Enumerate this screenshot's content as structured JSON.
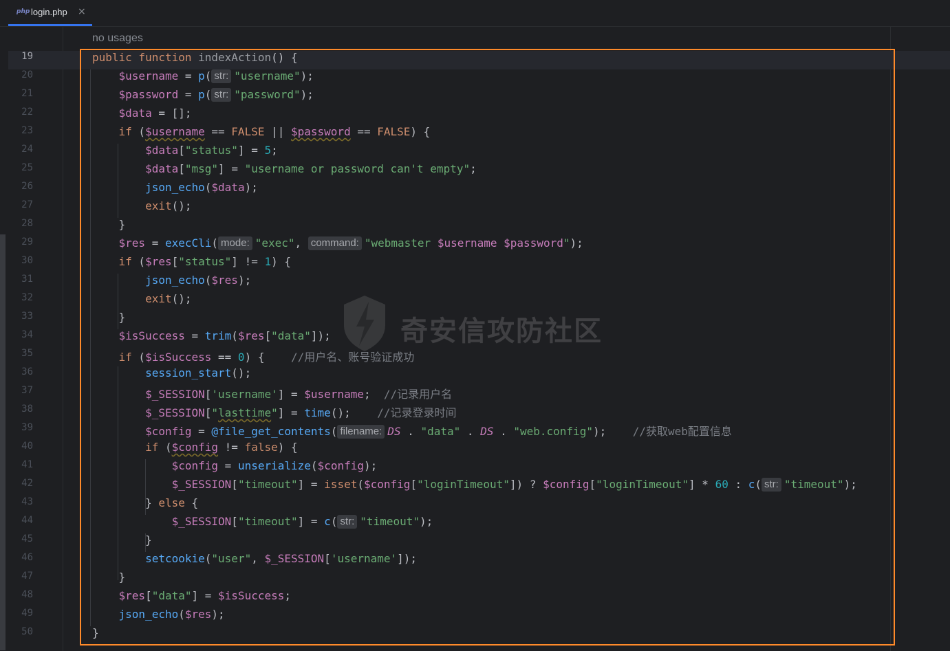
{
  "tab": {
    "icon": "php",
    "title": "login.php",
    "close": "×"
  },
  "hint_no_usages": "no usages",
  "lines": [
    {
      "ln": "19",
      "html": "<span class=\"t-kw\">public function</span> <span class=\"t-dim\">indexAction</span>() {"
    },
    {
      "ln": "20",
      "html": "    <span class=\"t-var\">$username</span> = <span class=\"t-fn\">p</span>(<span class=\"hint\">str:</span><span class=\"t-str\">\"username\"</span>);"
    },
    {
      "ln": "21",
      "html": "    <span class=\"t-var\">$password</span> = <span class=\"t-fn\">p</span>(<span class=\"hint\">str:</span><span class=\"t-str\">\"password\"</span>);"
    },
    {
      "ln": "22",
      "html": "    <span class=\"t-var\">$data</span> = [];"
    },
    {
      "ln": "23",
      "html": "    <span class=\"t-kw\">if</span> (<span class=\"t-var warn\">$username</span> == <span class=\"t-kw\">FALSE</span> || <span class=\"t-var warn\">$password</span> == <span class=\"t-kw\">FALSE</span>) {"
    },
    {
      "ln": "24",
      "html": "        <span class=\"t-var\">$data</span>[<span class=\"t-str\">\"status\"</span>] = <span class=\"t-num\">5</span>;"
    },
    {
      "ln": "25",
      "html": "        <span class=\"t-var\">$data</span>[<span class=\"t-str\">\"msg\"</span>] = <span class=\"t-str\">\"username or password can't empty\"</span>;"
    },
    {
      "ln": "26",
      "html": "        <span class=\"t-fn\">json_echo</span>(<span class=\"t-var\">$data</span>);"
    },
    {
      "ln": "27",
      "html": "        <span class=\"t-kw\">exit</span>();"
    },
    {
      "ln": "28",
      "html": "    }"
    },
    {
      "ln": "29",
      "html": "    <span class=\"t-var\">$res</span> = <span class=\"t-fn\">execCli</span>(<span class=\"hint\">mode:</span><span class=\"t-str\">\"exec\"</span>, <span class=\"hint\">command:</span><span class=\"t-str\">\"webmaster <span class=\"t-var\">$username</span> <span class=\"t-var\">$password</span>\"</span>);"
    },
    {
      "ln": "30",
      "html": "    <span class=\"t-kw\">if</span> (<span class=\"t-var\">$res</span>[<span class=\"t-str\">\"status\"</span>] != <span class=\"t-num\">1</span>) {"
    },
    {
      "ln": "31",
      "html": "        <span class=\"t-fn\">json_echo</span>(<span class=\"t-var\">$res</span>);"
    },
    {
      "ln": "32",
      "html": "        <span class=\"t-kw\">exit</span>();"
    },
    {
      "ln": "33",
      "html": "    }"
    },
    {
      "ln": "34",
      "html": "    <span class=\"t-var\">$isSuccess</span> = <span class=\"t-fn\">trim</span>(<span class=\"t-var\">$res</span>[<span class=\"t-str\">\"data\"</span>]);"
    },
    {
      "ln": "35",
      "html": "    <span class=\"t-kw\">if</span> (<span class=\"t-var\">$isSuccess</span> == <span class=\"t-num\">0</span>) {    <span class=\"t-cm\">//用户名、账号验证成功</span>"
    },
    {
      "ln": "36",
      "html": "        <span class=\"t-fn\">session_start</span>();"
    },
    {
      "ln": "37",
      "html": "        <span class=\"t-var\">$_SESSION</span>[<span class=\"t-str\">'username'</span>] = <span class=\"t-var\">$username</span>;  <span class=\"t-cm\">//记录用户名</span>"
    },
    {
      "ln": "38",
      "html": "        <span class=\"t-var\">$_SESSION</span>[<span class=\"t-str\">\"<span class=\"warn\">lasttime</span>\"</span>] = <span class=\"t-fn\">time</span>();    <span class=\"t-cm\">//记录登录时间</span>"
    },
    {
      "ln": "39",
      "html": "        <span class=\"t-var\">$config</span> = <span class=\"t-fn\">@file_get_contents</span>(<span class=\"hint\">filename:</span><span class=\"t-const\">DS</span> . <span class=\"t-str\">\"data\"</span> . <span class=\"t-const\">DS</span> . <span class=\"t-str\">\"web.config\"</span>);    <span class=\"t-cm\">//获取web配置信息</span>"
    },
    {
      "ln": "40",
      "html": "        <span class=\"t-kw\">if</span> (<span class=\"t-var warn\">$config</span> != <span class=\"t-kw\">false</span>) {"
    },
    {
      "ln": "41",
      "html": "            <span class=\"t-var\">$config</span> = <span class=\"t-fn\">unserialize</span>(<span class=\"t-var\">$config</span>);"
    },
    {
      "ln": "42",
      "html": "            <span class=\"t-var\">$_SESSION</span>[<span class=\"t-str\">\"timeout\"</span>] = <span class=\"t-kw\">isset</span>(<span class=\"t-var\">$config</span>[<span class=\"t-str\">\"loginTimeout\"</span>]) ? <span class=\"t-var\">$config</span>[<span class=\"t-str\">\"loginTimeout\"</span>] * <span class=\"t-num\">60</span> : <span class=\"t-fn\">c</span>(<span class=\"hint\">str:</span><span class=\"t-str\">\"timeout\"</span>);"
    },
    {
      "ln": "43",
      "html": "        } <span class=\"t-kw\">else</span> {"
    },
    {
      "ln": "44",
      "html": "            <span class=\"t-var\">$_SESSION</span>[<span class=\"t-str\">\"timeout\"</span>] = <span class=\"t-fn\">c</span>(<span class=\"hint\">str:</span><span class=\"t-str\">\"timeout\"</span>);"
    },
    {
      "ln": "45",
      "html": "        }"
    },
    {
      "ln": "46",
      "html": "        <span class=\"t-fn\">setcookie</span>(<span class=\"t-str\">\"user\"</span>, <span class=\"t-var\">$_SESSION</span>[<span class=\"t-str\">'username'</span>]);"
    },
    {
      "ln": "47",
      "html": "    }"
    },
    {
      "ln": "48",
      "html": "    <span class=\"t-var\">$res</span>[<span class=\"t-str\">\"data\"</span>] = <span class=\"t-var\">$isSuccess</span>;"
    },
    {
      "ln": "49",
      "html": "    <span class=\"t-fn\">json_echo</span>(<span class=\"t-var\">$res</span>);"
    },
    {
      "ln": "50",
      "html": "}"
    }
  ],
  "active_line": "19",
  "watermark": "奇安信攻防社区"
}
